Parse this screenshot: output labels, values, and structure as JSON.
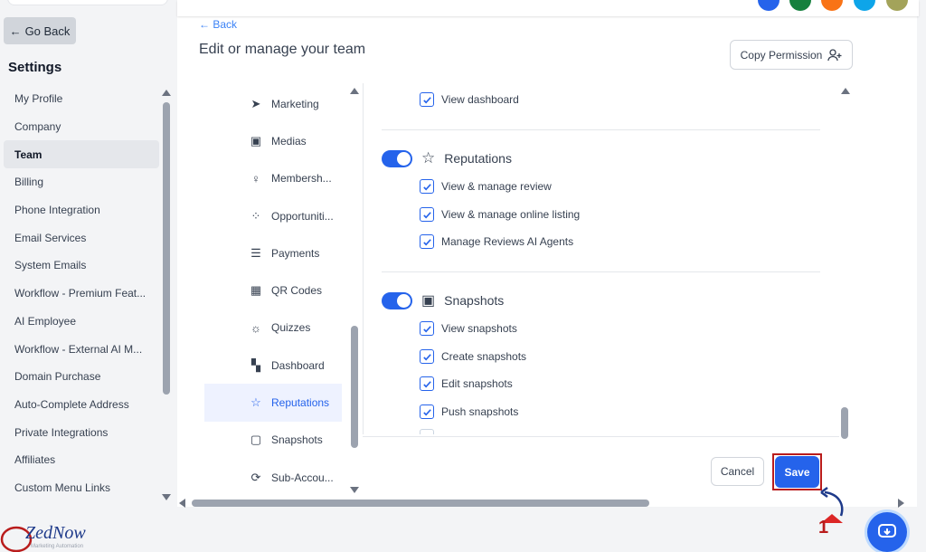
{
  "sidebar": {
    "go_back": "Go Back",
    "title": "Settings",
    "items": [
      {
        "label": "My Profile"
      },
      {
        "label": "Company"
      },
      {
        "label": "Team"
      },
      {
        "label": "Billing"
      },
      {
        "label": "Phone Integration"
      },
      {
        "label": "Email Services"
      },
      {
        "label": "System Emails"
      },
      {
        "label": "Workflow - Premium Feat..."
      },
      {
        "label": "AI Employee"
      },
      {
        "label": "Workflow - External AI M..."
      },
      {
        "label": "Domain Purchase"
      },
      {
        "label": "Auto-Complete Address"
      },
      {
        "label": "Private Integrations"
      },
      {
        "label": "Affiliates"
      },
      {
        "label": "Custom Menu Links"
      }
    ],
    "active": "Team"
  },
  "header": {
    "back": "Back",
    "title": "Edit or manage your team",
    "copy_permission": "Copy Permission"
  },
  "categories": [
    {
      "label": "Marketing",
      "icon": "send-icon"
    },
    {
      "label": "Medias",
      "icon": "image-icon"
    },
    {
      "label": "Membersh...",
      "icon": "award-icon"
    },
    {
      "label": "Opportuniti...",
      "icon": "funnel-icon"
    },
    {
      "label": "Payments",
      "icon": "bank-icon"
    },
    {
      "label": "QR Codes",
      "icon": "qr-icon"
    },
    {
      "label": "Quizzes",
      "icon": "bulb-icon"
    },
    {
      "label": "Dashboard",
      "icon": "grid-icon"
    },
    {
      "label": "Reputations",
      "icon": "star-icon"
    },
    {
      "label": "Snapshots",
      "icon": "portrait-icon"
    },
    {
      "label": "Sub-Accou...",
      "icon": "refresh-icon"
    }
  ],
  "permissions": {
    "top_item": "View dashboard",
    "reputations": {
      "title": "Reputations",
      "items": [
        "View & manage review",
        "View & manage online listing",
        "Manage Reviews AI Agents"
      ]
    },
    "snapshots": {
      "title": "Snapshots",
      "items": [
        "View snapshots",
        "Create snapshots",
        "Edit snapshots",
        "Push snapshots"
      ]
    }
  },
  "footer": {
    "cancel": "Cancel",
    "save": "Save"
  },
  "branding": {
    "logo": "ZedNow",
    "logo_sub": "Marketing Automation"
  },
  "annotation": {
    "number": "1"
  },
  "colors": {
    "accent": "#2563eb",
    "highlight": "#b91c1c"
  }
}
